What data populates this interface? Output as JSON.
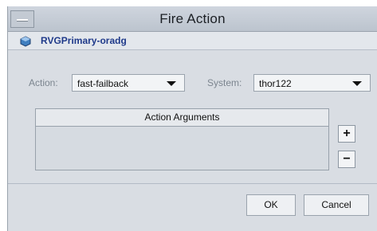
{
  "window": {
    "title": "Fire Action",
    "object_name": "RVGPrimary-oradg"
  },
  "form": {
    "action_label": "Action:",
    "action_value": "fast-failback",
    "system_label": "System:",
    "system_value": "thor122"
  },
  "arguments_table": {
    "header": "Action Arguments",
    "add_label": "+",
    "remove_label": "−"
  },
  "footer": {
    "ok_label": "OK",
    "cancel_label": "Cancel"
  },
  "icons": {
    "window_menu": "window-menu-icon",
    "object": "resource-object-icon",
    "dropdown": "chevron-down-icon"
  },
  "colors": {
    "object_name": "#1f3a8a",
    "dialog_bg": "#d9dde3",
    "titlebar": "#c6cdd6"
  }
}
